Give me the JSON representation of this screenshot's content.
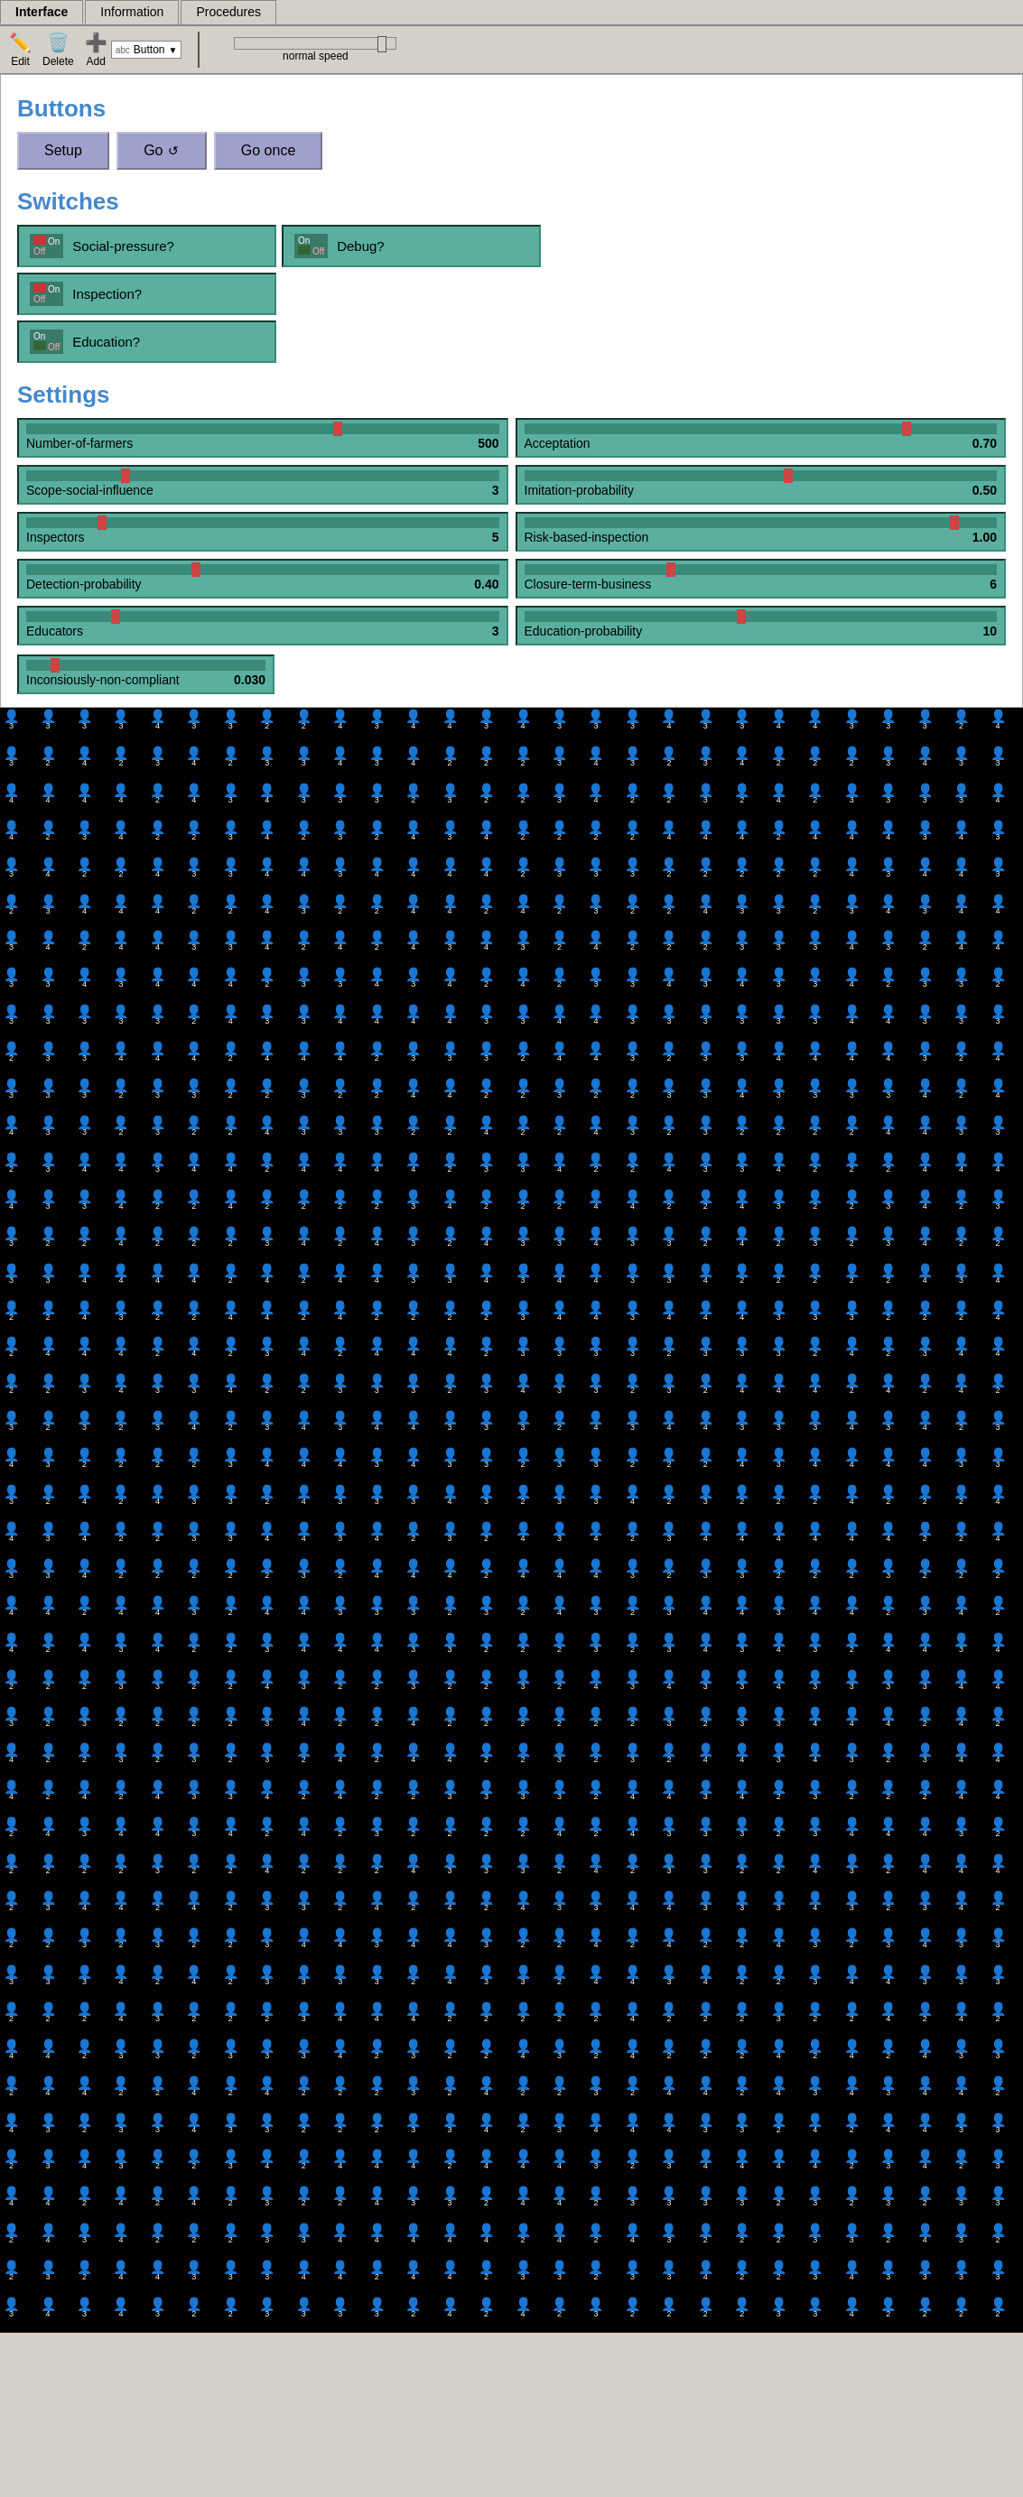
{
  "tabs": [
    {
      "label": "Interface",
      "active": true
    },
    {
      "label": "Information",
      "active": false
    },
    {
      "label": "Procedures",
      "active": false
    }
  ],
  "toolbar": {
    "edit_label": "Edit",
    "delete_label": "Delete",
    "add_label": "Add",
    "dropdown_label": "Button",
    "dropdown_prefix": "abc",
    "speed_label": "normal speed"
  },
  "sections": {
    "buttons": {
      "title": "Buttons",
      "items": [
        {
          "label": "Setup",
          "has_icon": false
        },
        {
          "label": "Go",
          "has_icon": true
        },
        {
          "label": "Go once",
          "has_icon": false
        }
      ]
    },
    "switches": {
      "title": "Switches",
      "items": [
        {
          "label": "Social-pressure?",
          "on": true
        },
        {
          "label": "Debug?",
          "on": false
        },
        {
          "label": "Inspection?",
          "on": true
        },
        {
          "label": "Education?",
          "on": false
        }
      ]
    },
    "settings": {
      "title": "Settings",
      "items": [
        {
          "label": "Number-of-farmers",
          "value": "500",
          "thumb_pct": 65
        },
        {
          "label": "Acceptation",
          "value": "0.70",
          "thumb_pct": 80
        },
        {
          "label": "Scope-social-influence",
          "value": "3",
          "thumb_pct": 20
        },
        {
          "label": "Imitation-probability",
          "value": "0.50",
          "thumb_pct": 55
        },
        {
          "label": "Inspectors",
          "value": "5",
          "thumb_pct": 15
        },
        {
          "label": "Risk-based-inspection",
          "value": "1.00",
          "thumb_pct": 90
        },
        {
          "label": "Detection-probability",
          "value": "0.40",
          "thumb_pct": 35
        },
        {
          "label": "Closure-term-business",
          "value": "6",
          "thumb_pct": 30
        },
        {
          "label": "Educators",
          "value": "3",
          "thumb_pct": 18
        },
        {
          "label": "Education-probability",
          "value": "10",
          "thumb_pct": 45
        },
        {
          "label": "Inconsiously-non-compliant",
          "value": "0.030",
          "thumb_pct": 10
        }
      ]
    }
  }
}
